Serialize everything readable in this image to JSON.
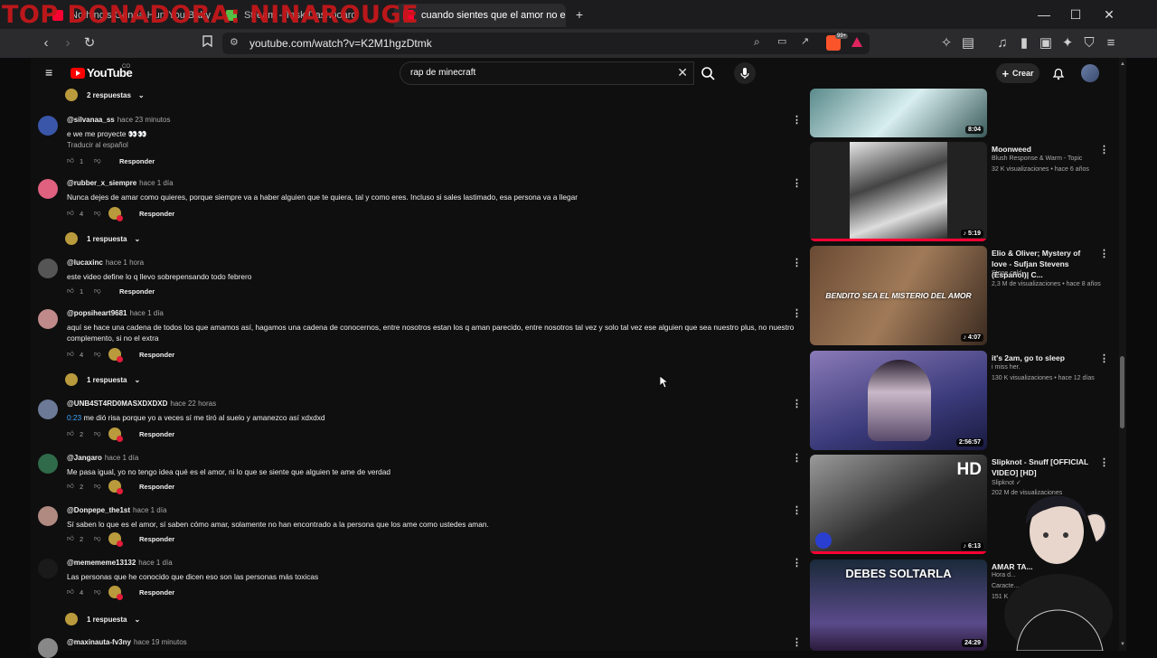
{
  "overlay_title": "TOP DONADORA: NINAROUGE",
  "tabs": [
    {
      "title": "Nothing's Gonna Hurt You Baby",
      "active": false,
      "favicon_color": "#ff0033"
    },
    {
      "title": "Stream - Task Dashboard",
      "active": false,
      "favicon_color": "#54c045"
    },
    {
      "title": "cuando sientes que el amor no e",
      "active": true,
      "favicon_color": "#ff0033"
    }
  ],
  "tab_new": "+",
  "window_controls": {
    "minimize": "—",
    "maximize": "☐",
    "close": "✕"
  },
  "browser": {
    "url": "youtube.com/watch?v=K2M1hgzDtmk",
    "brave_badge": "99+"
  },
  "youtube": {
    "logo_text": "YouTube",
    "logo_country": "CO",
    "search_query": "rap de minecraft",
    "create_label": "Crear"
  },
  "comments_top_replies": "2 respuestas",
  "comments": [
    {
      "author": "@silvanaa_ss",
      "time": "hace 23 minutos",
      "text": "e we me proyecte 👀👀",
      "translate": "Traducir al español",
      "likes": "1",
      "reply": "Responder",
      "creator_heart": false,
      "avatar_color": "#3a56a8"
    },
    {
      "author": "@rubber_x_siempre",
      "time": "hace 1 día",
      "text": "Nunca dejes de amar como quieres, porque siempre va a haber alguien que te quiera, tal y como eres. Incluso si sales lastimado, esa persona va a llegar",
      "likes": "4",
      "reply": "Responder",
      "creator_heart": true,
      "avatar_color": "#e06080",
      "replies": "1 respuesta"
    },
    {
      "author": "@lucaxinc",
      "time": "hace 1 hora",
      "text": "este video define lo q llevo sobrepensando todo febrero",
      "likes": "1",
      "reply": "Responder",
      "creator_heart": false,
      "avatar_color": "#555555"
    },
    {
      "author": "@popsiheart9681",
      "time": "hace 1 día",
      "text": "aquí se hace una cadena de todos los que amamos así, hagamos una cadena de conocernos, entre nosotros estan los q aman parecido, entre nosotros tal vez y solo tal vez ese alguien que sea nuestro plus, no nuestro complemento, si no el extra",
      "likes": "4",
      "reply": "Responder",
      "creator_heart": true,
      "avatar_color": "#c08a8a",
      "replies": "1 respuesta"
    },
    {
      "author": "@UNB4ST4RD0MASXDXDXD",
      "time": "hace 22 horas",
      "link": "0:23",
      "text": "me dió risa porque yo a veces sí me tiró al suelo y amanezco así xdxdxd",
      "likes": "2",
      "reply": "Responder",
      "creator_heart": true,
      "avatar_color": "#6c7a98"
    },
    {
      "author": "@Jangaro",
      "time": "hace 1 día",
      "text": "Me pasa igual, yo no tengo idea qué es el amor, ni lo que se siente que alguien te ame de verdad",
      "likes": "2",
      "reply": "Responder",
      "creator_heart": true,
      "avatar_color": "#2f6a4a"
    },
    {
      "author": "@Donpepe_the1st",
      "time": "hace 1 día",
      "text": "Sí saben lo que es el amor, sí saben cómo amar, solamente no han encontrado a la persona que los ame como ustedes aman.",
      "likes": "2",
      "reply": "Responder",
      "creator_heart": true,
      "avatar_color": "#b08a80"
    },
    {
      "author": "@memememe13132",
      "time": "hace 1 día",
      "text": "Las personas que he conocido que dicen eso son las personas más toxicas",
      "likes": "4",
      "reply": "Responder",
      "creator_heart": true,
      "avatar_color": "#1a1a1a",
      "replies": "1 respuesta"
    },
    {
      "author": "@maxinauta-fv3ny",
      "time": "hace 19 minutos",
      "text": "",
      "likes": "",
      "reply": "",
      "creator_heart": false,
      "avatar_color": "#888888"
    }
  ],
  "sidebar": [
    {
      "title": "",
      "channel": "",
      "meta": "",
      "duration": "8:04",
      "thumb_colors": [
        "#5a8a8a",
        "#d8eef0"
      ],
      "progress": 1.0
    },
    {
      "title": "Moonweed",
      "channel": "Blush Response & Warm - Topic",
      "meta": "32 K visualizaciones • hace 6 años",
      "duration": "♪ 5:19",
      "thumb_colors": [
        "#222222",
        "#e6e6e6"
      ],
      "progress": 1.0
    },
    {
      "title": "Elio & Oliver; Mystery of love - Sufjan Stevens (Español)| C...",
      "channel": "Stone cold",
      "meta": "2,3 M de visualizaciones • hace 8 años",
      "duration": "♪ 4:07",
      "thumb_colors": [
        "#6a4a34",
        "#a07a58"
      ],
      "overlay": "BENDITO SEA EL MISTERIO DEL AMOR",
      "progress": 0
    },
    {
      "title": "it's 2am, go to sleep",
      "channel": "i miss her.",
      "meta": "130 K visualizaciones • hace 12 días",
      "duration": "2:56:57",
      "thumb_colors": [
        "#3a3a7a",
        "#8a7ab8"
      ],
      "progress": 0
    },
    {
      "title": "Slipknot - Snuff [OFFICIAL VIDEO] [HD]",
      "channel": "Slipknot ✓",
      "meta": "202 M de visualizaciones",
      "duration": "♪ 6:13",
      "thumb_colors": [
        "#303030",
        "#9a9a9a"
      ],
      "badge": "HD",
      "progress": 1.0
    },
    {
      "title": "AMAR TA...",
      "channel": "Caracte...",
      "meta": "151 K",
      "duration": "24:29",
      "thumb_colors": [
        "#1a2a3a",
        "#5a4a8a"
      ],
      "overlay": "DEBES SOLTARLA",
      "extra_line": "Hora d...",
      "progress": 0
    }
  ]
}
